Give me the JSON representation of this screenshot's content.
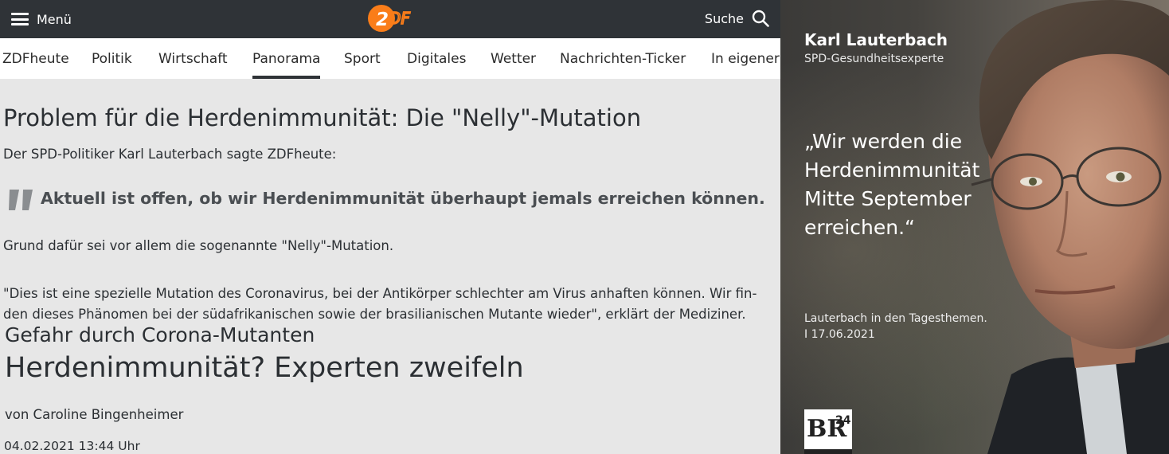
{
  "header": {
    "menu_label": "Menü",
    "logo_text": "ZDF",
    "search_label": "Suche"
  },
  "nav": {
    "items": [
      {
        "label": "ZDFheute"
      },
      {
        "label": "Politik"
      },
      {
        "label": "Wirtschaft"
      },
      {
        "label": "Panorama",
        "active": true
      },
      {
        "label": "Sport"
      },
      {
        "label": "Digitales"
      },
      {
        "label": "Wetter"
      },
      {
        "label": "Nachrichten-Ticker"
      },
      {
        "label": "In eigener"
      }
    ]
  },
  "article": {
    "title": "Problem für die Herdenimmunität: Die \"Nelly\"-Mutation",
    "intro": "Der SPD-Politiker Karl Lauterbach sagte ZDFheute:",
    "quote": "Aktuell ist offen, ob wir Herdenimmunität überhaupt jemals erreichen können.",
    "paragraph_1": "Grund dafür sei vor allem die sogenannte \"Nelly\"-Mutation.",
    "paragraph_2": "\"Dies ist eine spezielle Mutation des Coronavirus, bei der Antikörper schlechter am Virus anhaften können. Wir fin-den dieses Phänomen bei der südafrikanischen sowie der brasilianischen Mutante wieder\", erklärt der Mediziner."
  },
  "teaser": {
    "kicker": "Gefahr durch Corona-Mutanten",
    "headline": "Herdenimmunität? Experten zweifeln",
    "author": "von Caroline Bingenheimer",
    "date": "04.02.2021 13:44 Uhr"
  },
  "quote_card": {
    "name": "Karl Lauterbach",
    "role": "SPD-Gesundheitsexperte",
    "quote": "„Wir werden die Herdenimmunität Mitte September erreichen.“",
    "caption_line_1": "Lauterbach in den Tagesthemen.",
    "caption_line_2": "I 17.06.2021",
    "logo_text": "BR24"
  },
  "colors": {
    "header_bg": "#2f3337",
    "zdf_orange": "#fa7d19",
    "page_bg": "#e7e7e7",
    "text": "#2b2f33"
  }
}
